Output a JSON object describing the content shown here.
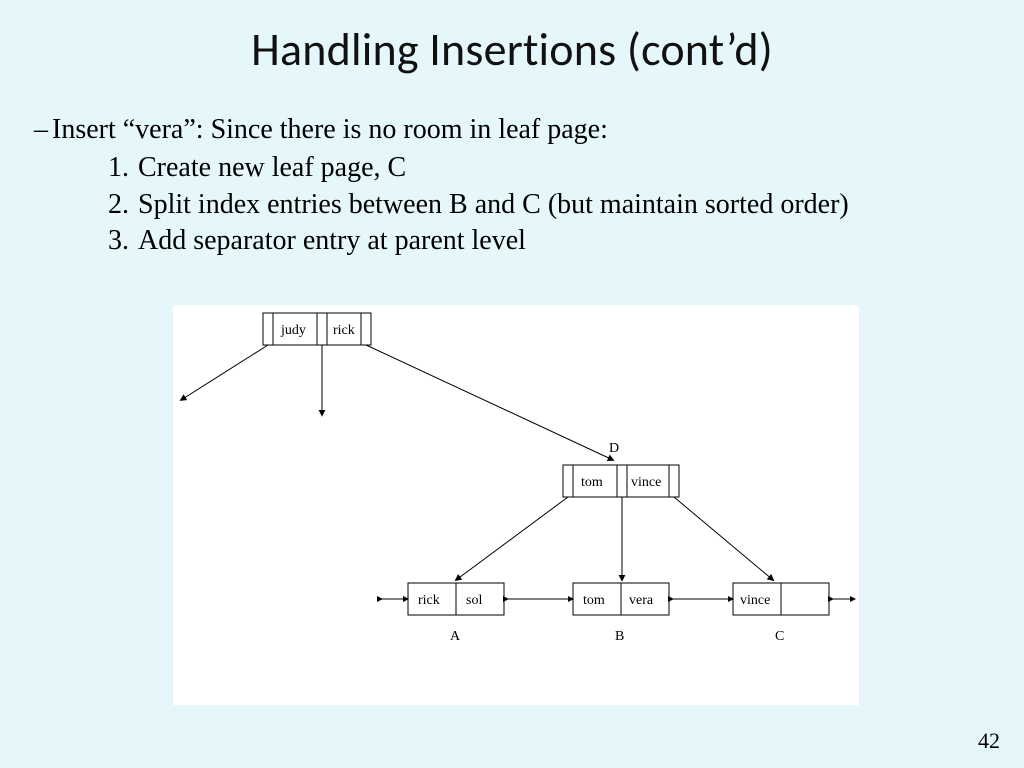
{
  "title": "Handling Insertions (cont’d)",
  "bullet": {
    "dash": "–",
    "text": "Insert “vera”:  Since there is no room in leaf page:"
  },
  "steps": [
    {
      "num": "1.",
      "text": "Create new leaf page, C"
    },
    {
      "num": "2.",
      "text": "Split index entries between B and C (but maintain sorted order)"
    },
    {
      "num": "3.",
      "text": "Add separator entry at parent level"
    }
  ],
  "diagram": {
    "root": {
      "k1": "judy",
      "k2": "rick"
    },
    "d_label": "D",
    "d_node": {
      "k1": "tom",
      "k2": "vince"
    },
    "leaves": [
      {
        "label": "A",
        "k1": "rick",
        "k2": "sol"
      },
      {
        "label": "B",
        "k1": "tom",
        "k2": "vera"
      },
      {
        "label": "C",
        "k1": "vince",
        "k2": ""
      }
    ]
  },
  "page_number": "42"
}
